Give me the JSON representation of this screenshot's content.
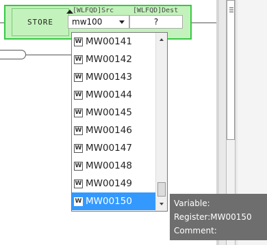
{
  "ladder": {
    "block_name": "STORE",
    "src_header": "[WLFQD]Src",
    "dest_header": "[WLFQD]Dest",
    "src_value": "mw100",
    "dest_value": "?"
  },
  "dropdown": {
    "icon_label": "W",
    "items": [
      "MW00141",
      "MW00142",
      "MW00143",
      "MW00144",
      "MW00145",
      "MW00146",
      "MW00147",
      "MW00148",
      "MW00149",
      "MW00150"
    ],
    "selected": "MW00150"
  },
  "tooltip": {
    "variable_line": "Variable:",
    "register_line": "Register:MW00150",
    "comment_line": "Comment:"
  }
}
